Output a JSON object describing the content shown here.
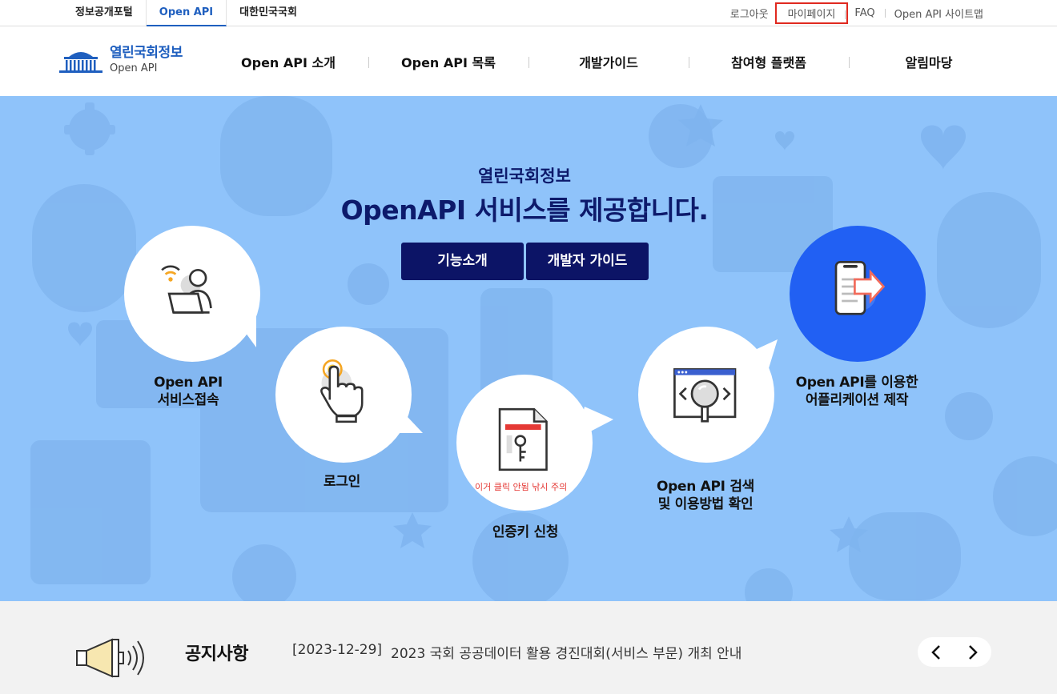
{
  "topbar": {
    "portal_tabs": [
      "정보공개포털",
      "Open API",
      "대한민국국회"
    ],
    "util_links": [
      "로그아웃",
      "마이페이지",
      "FAQ",
      "Open API 사이트맵"
    ]
  },
  "header": {
    "logo_title": "열린국회정보",
    "logo_sub": "Open API",
    "menu": [
      "Open API 소개",
      "Open API 목록",
      "개발가이드",
      "참여형 플랫폼",
      "알림마당"
    ]
  },
  "hero": {
    "subtitle": "열린국회정보",
    "title": "OpenAPI 서비스를 제공합니다.",
    "buttons": [
      "기능소개",
      "개발자 가이드"
    ],
    "steps": [
      {
        "line1": "Open API",
        "line2": "서비스접속",
        "icon": "user-laptop-wifi-icon"
      },
      {
        "line1": "로그인",
        "line2": "",
        "icon": "finger-touch-icon"
      },
      {
        "line1": "인증키 신청",
        "line2": "",
        "icon": "key-document-icon"
      },
      {
        "line1": "Open API 검색",
        "line2": "및 이용방법 확인",
        "icon": "magnifier-window-icon"
      },
      {
        "line1": "Open API를 이용한",
        "line2": "어플리케이션 제작",
        "icon": "phone-arrow-icon"
      }
    ],
    "warning_text": "이거 클릭 안됨 낚시 주의"
  },
  "notice": {
    "title": "공지사항",
    "date": "[2023-12-29]",
    "text": "2023 국회 공공데이터 활용 경진대회(서비스 부문) 개최 안내"
  },
  "colors": {
    "hero_bg": "#8fc3fa",
    "navy": "#0c1466",
    "brand_blue": "#1f5fbf",
    "accent_blue": "#2160f3",
    "highlight_red": "#e0291f"
  }
}
